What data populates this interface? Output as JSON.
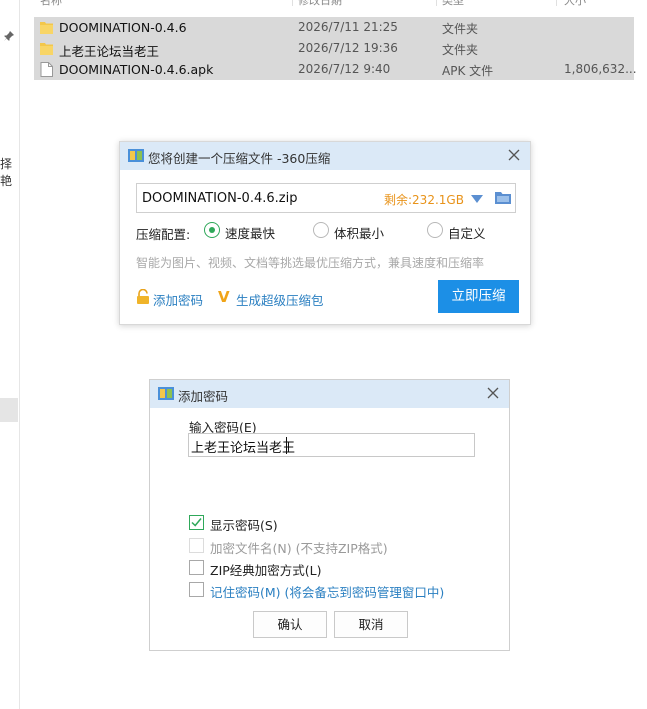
{
  "explorer": {
    "left_rail_text": "择艳",
    "columns": {
      "name": "名称",
      "date": "修改日期",
      "type": "类型",
      "size": "大小"
    },
    "files": [
      {
        "name": "DOOMINATION-0.4.6",
        "date": "2026/7/11 21:25",
        "type": "文件夹",
        "size": "",
        "icon": "folder-icon"
      },
      {
        "name": "上老王论坛当老王",
        "date": "2026/7/12 19:36",
        "type": "文件夹",
        "size": "",
        "icon": "folder-icon"
      },
      {
        "name": "DOOMINATION-0.4.6.apk",
        "date": "2026/7/12 9:40",
        "type": "APK 文件",
        "size": "1,806,632...",
        "icon": "file-icon"
      }
    ]
  },
  "compress_dialog": {
    "title": "您将创建一个压缩文件 -360压缩",
    "path": "DOOMINATION-0.4.6.zip",
    "free_space": "剩余:232.1GB",
    "config_label": "压缩配置:",
    "options": [
      {
        "label": "速度最快",
        "selected": true
      },
      {
        "label": "体积最小",
        "selected": false
      },
      {
        "label": "自定义",
        "selected": false
      }
    ],
    "hint": "智能为图片、视频、文档等挑选最优压缩方式，兼具速度和压缩率",
    "add_password_link": "添加密码",
    "super_package_link": "生成超级压缩包",
    "compress_button": "立即压缩",
    "accent_color": "#1c8fe6"
  },
  "password_dialog": {
    "title": "添加密码",
    "input_label": "输入密码(E)",
    "password_value": "上老王论坛当老王",
    "checkboxes": {
      "show_password": {
        "label": "显示密码(S)",
        "note": "",
        "checked": true,
        "disabled": false
      },
      "encrypt_filename": {
        "label": "加密文件名(N)",
        "note": " (不支持ZIP格式)",
        "checked": false,
        "disabled": true
      },
      "zip_classic": {
        "label": "ZIP经典加密方式(L)",
        "note": "",
        "checked": false,
        "disabled": false
      },
      "remember_password": {
        "label": "记住密码(M)",
        "note": " (将会备忘到密码管理窗口中)",
        "checked": false,
        "disabled": false
      }
    },
    "ok_button": "确认",
    "cancel_button": "取消"
  }
}
